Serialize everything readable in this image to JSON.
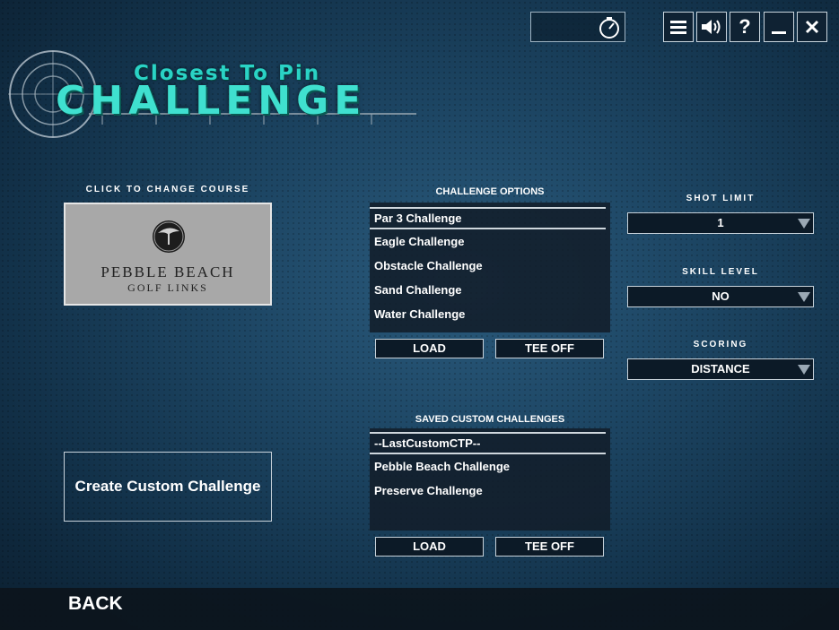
{
  "title_line1": "Closest To Pin",
  "title_line2": "CHALLENGE",
  "toolbar": {
    "menu_icon": "≡",
    "sound_icon": "🔊",
    "help_icon": "?",
    "minimize_icon": "_",
    "close_icon": "✕"
  },
  "course": {
    "label": "CLICK TO CHANGE COURSE",
    "name_line1": "PEBBLE BEACH",
    "name_line2": "GOLF LINKS"
  },
  "challenge_options": {
    "heading": "CHALLENGE OPTIONS",
    "items": [
      "Par 3 Challenge",
      "Eagle Challenge",
      "Obstacle Challenge",
      "Sand Challenge",
      "Water Challenge"
    ],
    "load_label": "LOAD",
    "teeoff_label": "TEE OFF"
  },
  "saved": {
    "heading": "SAVED CUSTOM CHALLENGES",
    "items": [
      "--LastCustomCTP--",
      "Pebble Beach Challenge",
      "Preserve Challenge"
    ],
    "load_label": "LOAD",
    "teeoff_label": "TEE OFF"
  },
  "create_label": "Create Custom Challenge",
  "settings": {
    "shot_limit_label": "SHOT LIMIT",
    "shot_limit_value": "1",
    "skill_level_label": "SKILL LEVEL",
    "skill_level_value": "NO",
    "scoring_label": "SCORING",
    "scoring_value": "DISTANCE"
  },
  "back_label": "BACK"
}
